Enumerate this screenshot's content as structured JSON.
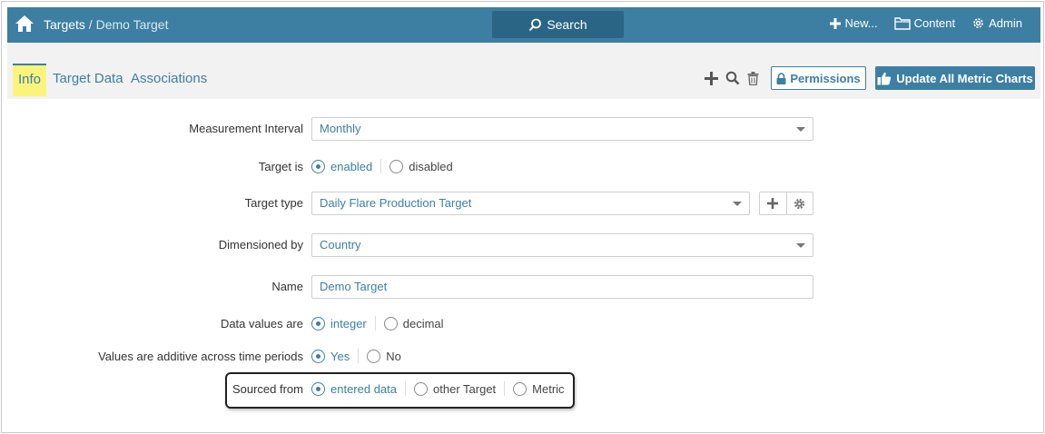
{
  "header": {
    "breadcrumb_root": "Targets",
    "breadcrumb_current": " / Demo Target",
    "search_label": "Search",
    "new_label": "New...",
    "content_label": "Content",
    "admin_label": "Admin"
  },
  "tabs": {
    "info": "Info",
    "target_data": "Target Data",
    "associations": "Associations"
  },
  "actions": {
    "permissions_label": "Permissions",
    "update_label": "Update All Metric Charts"
  },
  "form": {
    "measurement_interval": {
      "label": "Measurement Interval",
      "value": "Monthly"
    },
    "target_is": {
      "label": "Target is",
      "options": [
        "enabled",
        "disabled"
      ],
      "selected": "enabled"
    },
    "target_type": {
      "label": "Target type",
      "value": "Daily Flare Production Target"
    },
    "dimensioned_by": {
      "label": "Dimensioned by",
      "value": "Country"
    },
    "name": {
      "label": "Name",
      "value": "Demo Target"
    },
    "data_values": {
      "label": "Data values are",
      "options": [
        "integer",
        "decimal"
      ],
      "selected": "integer"
    },
    "additive": {
      "label": "Values are additive across time periods",
      "options": [
        "Yes",
        "No"
      ],
      "selected": "Yes"
    },
    "sourced_from": {
      "label": "Sourced from",
      "options": [
        "entered data",
        "other Target",
        "Metric"
      ],
      "selected": "entered data"
    }
  },
  "colors": {
    "brand": "#3d7fa3",
    "search_bg": "#2b6585",
    "tab_highlight": "#fbf47c"
  }
}
